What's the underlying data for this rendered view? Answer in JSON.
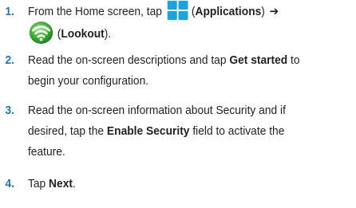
{
  "steps": [
    {
      "num": "1.",
      "line1_a": "From the Home screen, tap",
      "apps_icon": "applications-grid-icon",
      "line1_b_open": "(",
      "line1_b_bold": "Applications",
      "line1_b_close": ")",
      "arrow": "➔",
      "lookout_icon": "lookout-wifi-shield-icon",
      "line2_open": "(",
      "line2_bold": "Lookout",
      "line2_close": ")."
    },
    {
      "num": "2.",
      "a": "Read the on-screen descriptions and tap",
      "bold": "Get started",
      "b": "to",
      "line2": "begin your configuration."
    },
    {
      "num": "3.",
      "line1": "Read the on-screen information about Security and if",
      "a": "desired, tap the",
      "bold": "Enable Security",
      "b": "field to activate the",
      "line3": "feature."
    },
    {
      "num": "4.",
      "a": "Tap",
      "bold": "Next",
      "b": "."
    }
  ],
  "colors": {
    "step_number": "#1f76b9",
    "text": "#231f20",
    "apps_icon": "#1aa3dc",
    "lookout_green": "#3aa935"
  }
}
